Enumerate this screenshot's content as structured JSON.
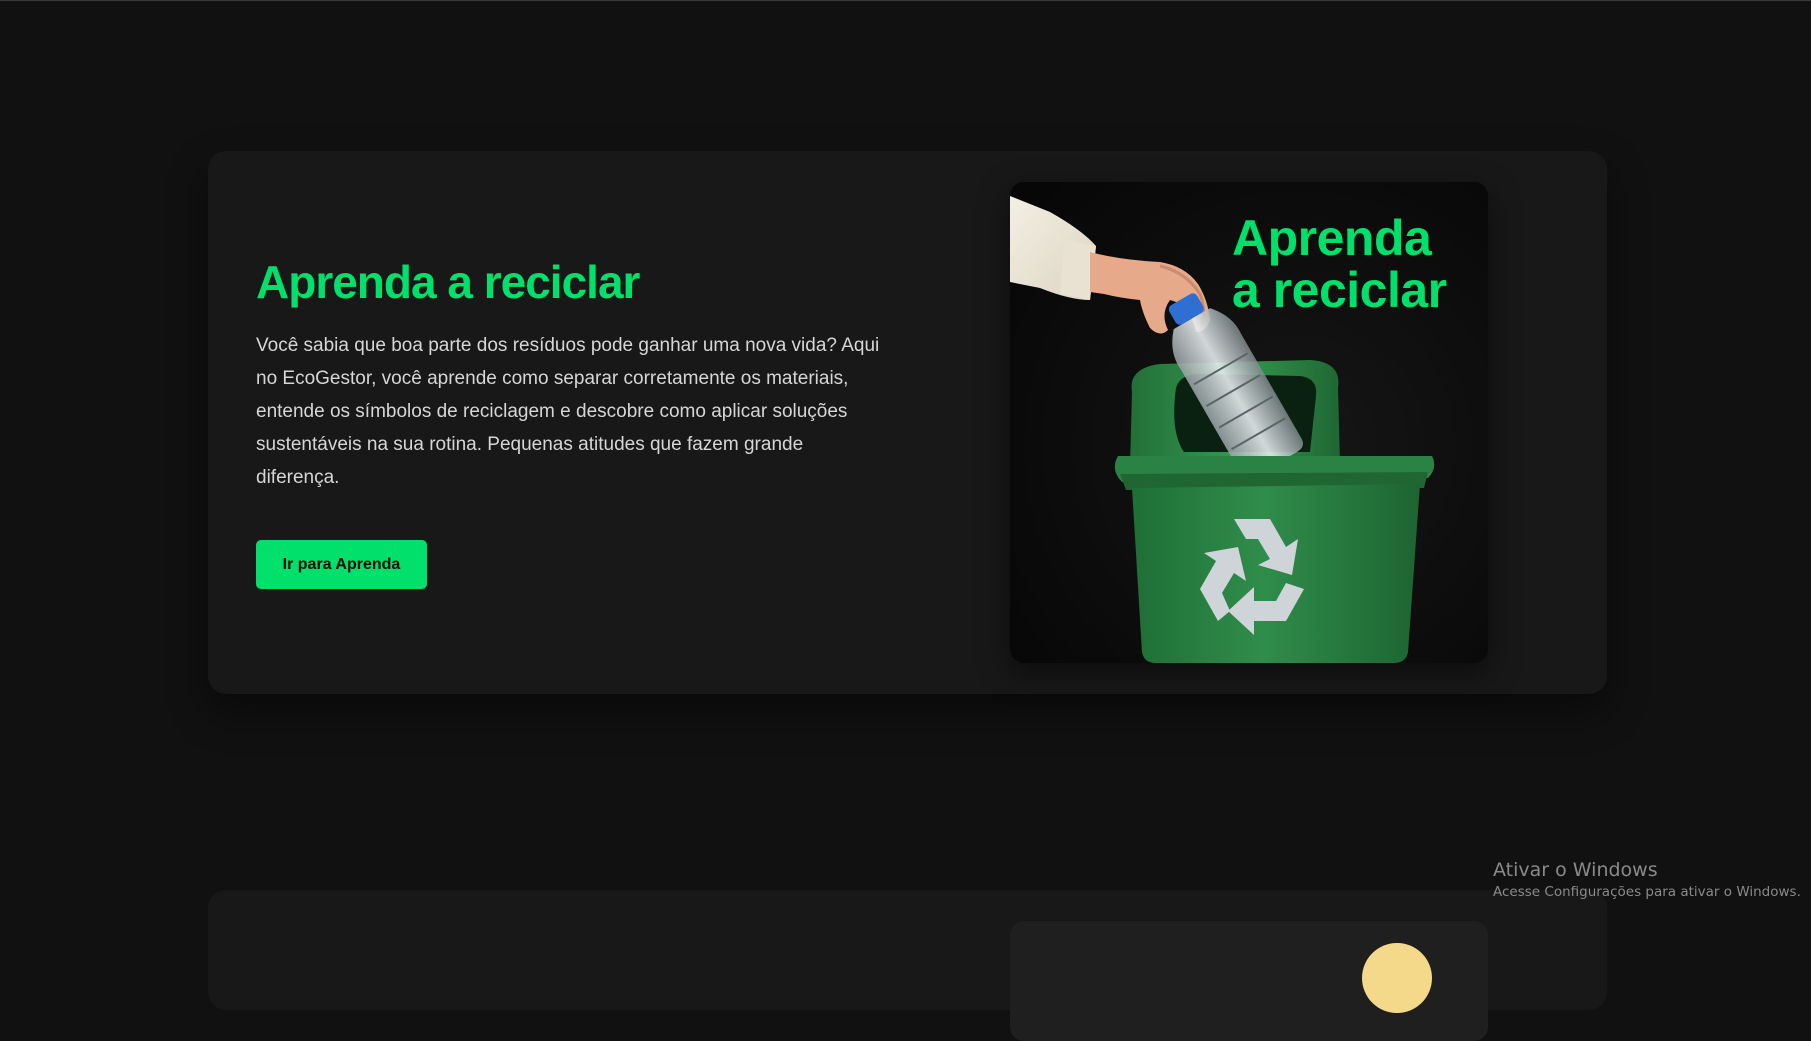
{
  "section": {
    "title": "Aprenda a reciclar",
    "body": "Você sabia que boa parte dos resíduos pode ganhar uma nova vida? Aqui no EcoGestor, você aprende como separar corretamente os materiais, entende os símbolos de reciclagem e descobre como aplicar soluções sustentáveis na sua rotina. Pequenas atitudes que fazem grande diferença.",
    "cta_label": "Ir para Aprenda",
    "image_title_line1": "Aprenda",
    "image_title_line2": "a reciclar",
    "image_icon": "recycle-icon"
  },
  "watermark": {
    "title": "Ativar o Windows",
    "subtitle": "Acesse Configurações para ativar o Windows."
  },
  "colors": {
    "page_bg": "#111111",
    "card_bg": "#181818",
    "accent": "#00e06a",
    "text": "#d6d6d6",
    "bin_green": "#2e8b4a"
  }
}
